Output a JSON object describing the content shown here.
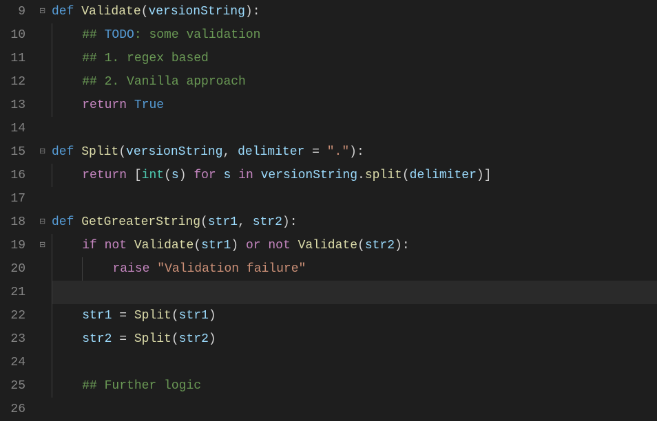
{
  "lines": {
    "9": "9",
    "10": "10",
    "11": "11",
    "12": "12",
    "13": "13",
    "14": "14",
    "15": "15",
    "16": "16",
    "17": "17",
    "18": "18",
    "19": "19",
    "20": "20",
    "21": "21",
    "22": "22",
    "23": "23",
    "24": "24",
    "25": "25",
    "26": "26"
  },
  "tok": {
    "def": "def",
    "return": "return",
    "if": "if",
    "not": "not",
    "or": "or",
    "raise": "raise",
    "for": "for",
    "in": "in",
    "true": "True",
    "int": "int",
    "validate": "Validate",
    "split": "Split",
    "getgreater": "GetGreaterString",
    "splitmethod": "split",
    "versionString": "versionString",
    "delimiter": "delimiter",
    "s": "s",
    "str1": "str1",
    "str2": "str2",
    "dot": "\".\"",
    "validation_failure": "\"Validation failure\"",
    "c_todo_hash": "## ",
    "c_todo_kw": "TODO",
    "c_todo_rest": ": some validation",
    "c_regex": "## 1. regex based",
    "c_vanilla": "## 2. Vanilla approach",
    "c_further": "## Further logic",
    "lparen": "(",
    "rparen": ")",
    "lbrack": "[",
    "rbrack": "]",
    "colon": ":",
    "comma": ", ",
    "eq": " = ",
    "dotop": "."
  }
}
